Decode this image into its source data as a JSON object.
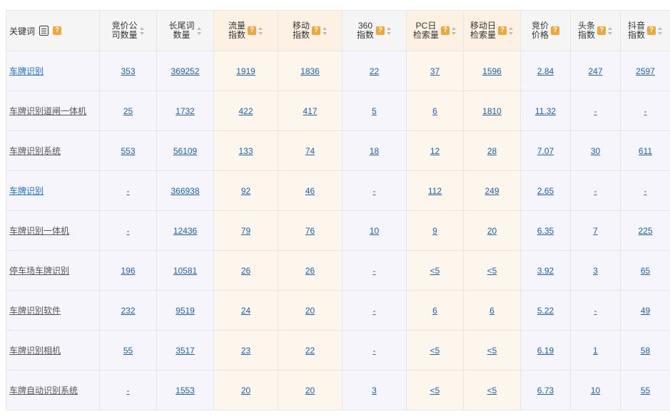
{
  "header": {
    "keyword": "关键词",
    "columns": [
      {
        "l1": "竞价公",
        "l2": "司数量",
        "help": false,
        "sort": true
      },
      {
        "l1": "长尾词",
        "l2": "数量",
        "help": false,
        "sort": true
      },
      {
        "l1": "流量",
        "l2": "指数",
        "help": true,
        "sort": true
      },
      {
        "l1": "移动",
        "l2": "指数",
        "help": true,
        "sort": true
      },
      {
        "l1": "360",
        "l2": "指数",
        "help": true,
        "sort": true
      },
      {
        "l1": "PC日",
        "l2": "检索量",
        "help": true,
        "sort": true
      },
      {
        "l1": "移动日",
        "l2": "检索量",
        "help": true,
        "sort": true
      },
      {
        "l1": "竞价",
        "l2": "价格",
        "help": true,
        "sort": false
      },
      {
        "l1": "头条",
        "l2": "指数",
        "help": true,
        "sort": true
      },
      {
        "l1": "抖音",
        "l2": "指数",
        "help": true,
        "sort": true
      }
    ],
    "help_glyph": "?"
  },
  "rows": [
    {
      "kw": "车牌识别",
      "kw_style": "blue",
      "vals": [
        "353",
        "369252",
        "1919",
        "1836",
        "22",
        "37",
        "1596",
        "2.84",
        "247",
        "2597"
      ]
    },
    {
      "kw": "车牌识别道闸一体机",
      "kw_style": "mixed",
      "vals": [
        "25",
        "1732",
        "422",
        "417",
        "5",
        "6",
        "1810",
        "11.32",
        "-",
        "-"
      ]
    },
    {
      "kw": "车牌识别系统",
      "kw_style": "mixed",
      "vals": [
        "553",
        "56109",
        "133",
        "74",
        "18",
        "12",
        "28",
        "7.07",
        "30",
        "611"
      ]
    },
    {
      "kw": "车牌识别",
      "kw_style": "blue",
      "vals": [
        "-",
        "366938",
        "92",
        "46",
        "-",
        "112",
        "249",
        "2.65",
        "-",
        "-"
      ]
    },
    {
      "kw": "车牌识别一体机",
      "kw_style": "mixed",
      "vals": [
        "-",
        "12436",
        "79",
        "76",
        "10",
        "9",
        "20",
        "6.35",
        "7",
        "225"
      ]
    },
    {
      "kw": "停车场车牌识别",
      "kw_style": "mixed",
      "vals": [
        "196",
        "10581",
        "26",
        "26",
        "-",
        "<5",
        "<5",
        "3.92",
        "3",
        "65"
      ]
    },
    {
      "kw": "车牌识别软件",
      "kw_style": "mixed",
      "vals": [
        "232",
        "9519",
        "24",
        "20",
        "-",
        "6",
        "6",
        "5.22",
        "-",
        "49"
      ]
    },
    {
      "kw": "车牌识别相机",
      "kw_style": "mixed",
      "vals": [
        "55",
        "3517",
        "23",
        "22",
        "-",
        "<5",
        "<5",
        "6.19",
        "1",
        "58"
      ]
    },
    {
      "kw": "车牌自动识别系统",
      "kw_style": "mixed",
      "vals": [
        "-",
        "1553",
        "20",
        "20",
        "3",
        "<5",
        "<5",
        "6.73",
        "10",
        "55"
      ]
    }
  ]
}
